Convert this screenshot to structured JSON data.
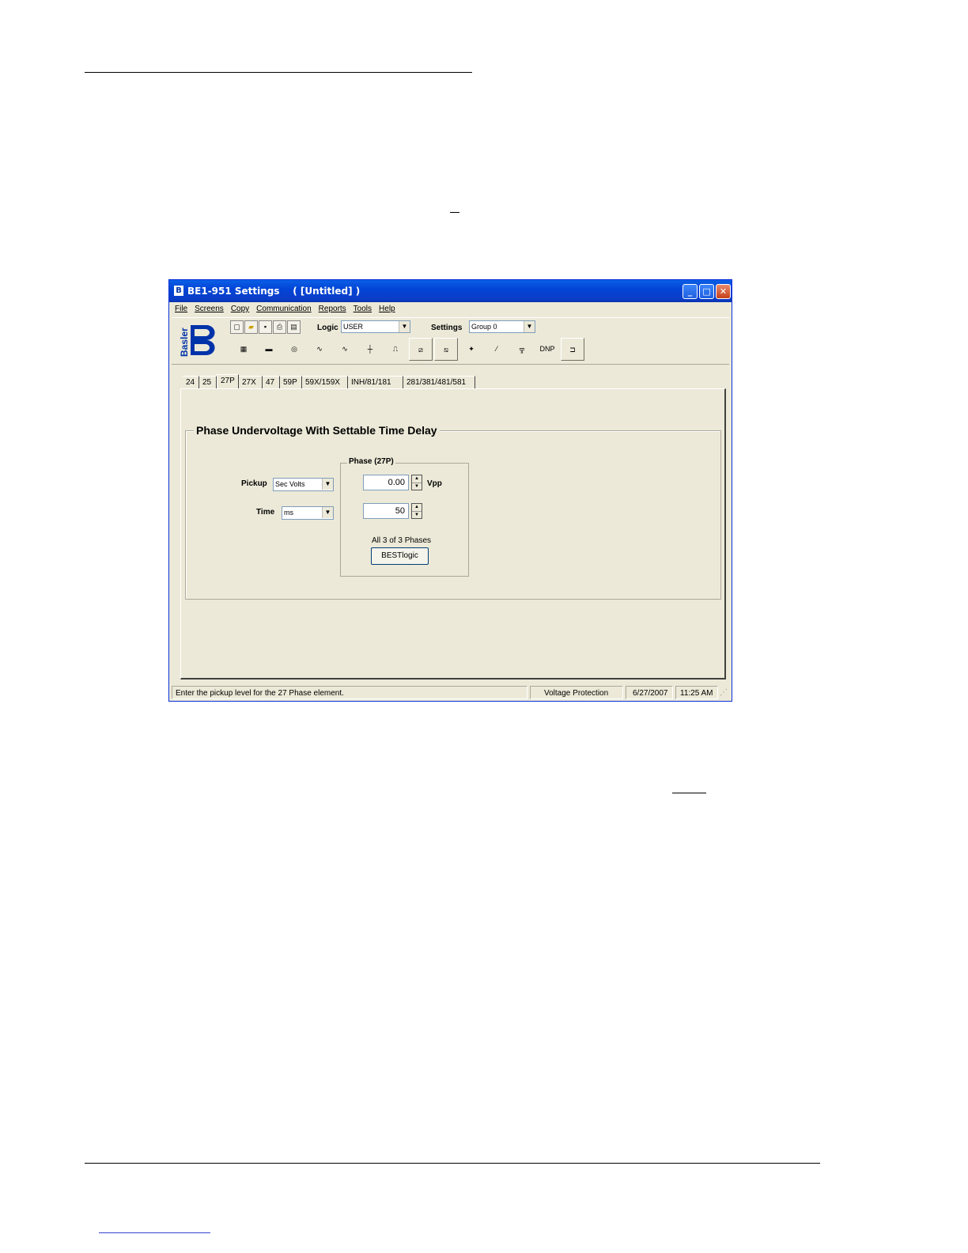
{
  "window": {
    "title": "BE1-951 Settings    ( [Untitled] )",
    "controls": {
      "minimize": "_",
      "maximize": "□",
      "close": "✕"
    }
  },
  "menu": [
    "File",
    "Screens",
    "Copy",
    "Communication",
    "Reports",
    "Tools",
    "Help"
  ],
  "toolbar": {
    "logo_text": "Basler",
    "logic_label": "Logic",
    "logic_value": "USER",
    "settings_label": "Settings",
    "settings_value": "Group 0",
    "dnp_label": "DNP"
  },
  "tabs": [
    "24",
    "25",
    "27P",
    "27X",
    "47",
    "59P",
    "59X/159X",
    "INH/81/181",
    "281/381/481/581"
  ],
  "active_tab": "27P",
  "panel": {
    "group_title": "Phase Undervoltage With Settable Time Delay",
    "pickup_label": "Pickup",
    "pickup_unit": "Sec Volts",
    "time_label": "Time",
    "time_unit": "ms",
    "phase_group_title": "Phase (27P)",
    "pickup_value": "0.00",
    "pickup_units_suffix": "Vpp",
    "time_value": "50",
    "phases_text": "All 3 of 3 Phases",
    "bestlogic_button": "BESTlogic"
  },
  "status": {
    "hint": "Enter the pickup level for the 27 Phase element.",
    "screen": "Voltage Protection",
    "date": "6/27/2007",
    "time": "11:25 AM"
  }
}
